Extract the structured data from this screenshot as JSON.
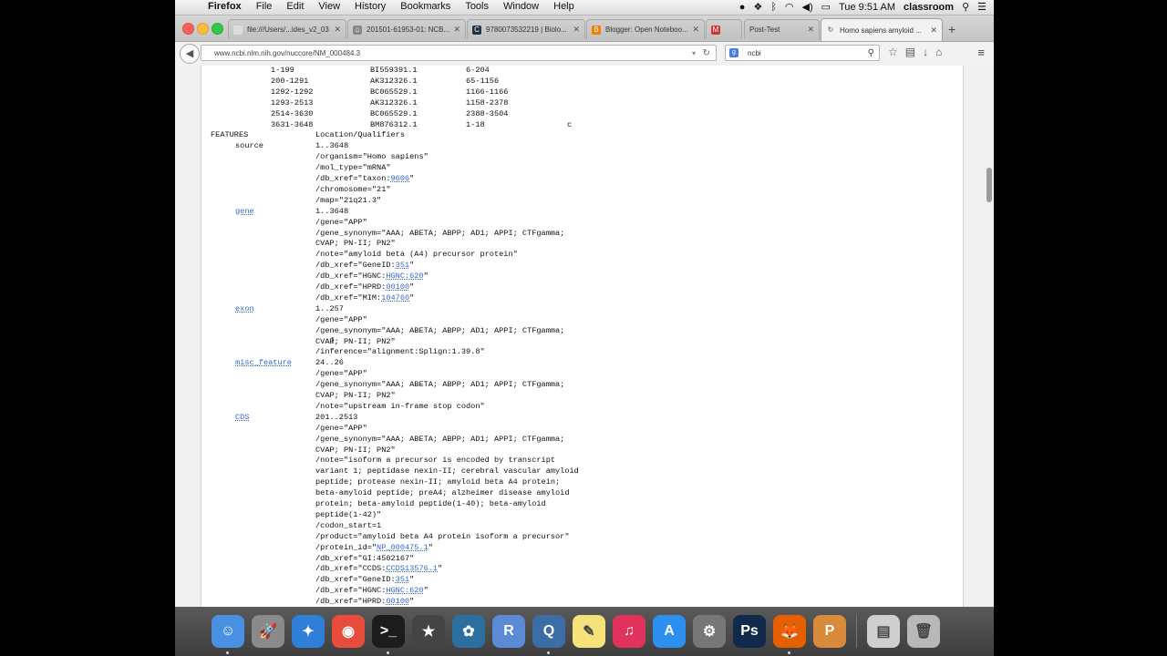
{
  "menubar": {
    "apple": "",
    "app_name": "Firefox",
    "menus": [
      "File",
      "Edit",
      "View",
      "History",
      "Bookmarks",
      "Tools",
      "Window",
      "Help"
    ],
    "clock": "Tue 9:51 AM",
    "user": "classroom"
  },
  "tabs": [
    {
      "title": "file:///Users/...ides_v2_03.swf",
      "favicon": "file-icon",
      "active": false
    },
    {
      "title": "201501-61953-01: NCB...",
      "favicon": "document-icon",
      "active": false
    },
    {
      "title": "9780073532219 | Biolo...",
      "favicon": "cengage-icon",
      "active": false
    },
    {
      "title": "Blogger: Open Noteboo...",
      "favicon": "blogger-icon",
      "active": false
    },
    {
      "title": "",
      "favicon": "gmail-icon",
      "active": false
    },
    {
      "title": "Post-Test",
      "favicon": "",
      "active": false
    },
    {
      "title": "Homo sapiens amyloid ...",
      "favicon": "loading-icon",
      "active": true
    }
  ],
  "navbar": {
    "url": "www.ncbi.nlm.nih.gov/nuccore/NM_000484.3",
    "search_value": "ncbi"
  },
  "genbank": {
    "primary": [
      {
        "range": "1-199",
        "acc": "BI559391.1",
        "span": "6-204",
        "comp": ""
      },
      {
        "range": "200-1291",
        "acc": "AK312326.1",
        "span": "65-1156",
        "comp": ""
      },
      {
        "range": "1292-1292",
        "acc": "BC065529.1",
        "span": "1166-1166",
        "comp": ""
      },
      {
        "range": "1293-2513",
        "acc": "AK312326.1",
        "span": "1158-2378",
        "comp": ""
      },
      {
        "range": "2514-3630",
        "acc": "BC065529.1",
        "span": "2388-3504",
        "comp": ""
      },
      {
        "range": "3631-3648",
        "acc": "BM876312.1",
        "span": "1-18",
        "comp": "c"
      }
    ],
    "features_header": {
      "key": "FEATURES",
      "value": "Location/Qualifiers"
    },
    "lines": [
      {
        "key": "source",
        "link": false,
        "parts": [
          {
            "t": "1..3648"
          }
        ]
      },
      {
        "parts": [
          {
            "t": "/organism=\"Homo sapiens\""
          }
        ]
      },
      {
        "parts": [
          {
            "t": "/mol_type=\"mRNA\""
          }
        ]
      },
      {
        "parts": [
          {
            "t": "/db_xref=\"taxon:"
          },
          {
            "t": "9606",
            "l": true
          },
          {
            "t": "\""
          }
        ]
      },
      {
        "parts": [
          {
            "t": "/chromosome=\"21\""
          }
        ]
      },
      {
        "parts": [
          {
            "t": "/map=\"21q21.3\""
          }
        ]
      },
      {
        "key": "gene",
        "link": true,
        "parts": [
          {
            "t": "1..3648"
          }
        ]
      },
      {
        "parts": [
          {
            "t": "/gene=\"APP\""
          }
        ]
      },
      {
        "parts": [
          {
            "t": "/gene_synonym=\"AAA; ABETA; ABPP; AD1; APPI; CTFgamma;"
          }
        ]
      },
      {
        "parts": [
          {
            "t": "CVAP; PN-II; PN2\""
          }
        ]
      },
      {
        "parts": [
          {
            "t": "/note=\"amyloid beta (A4) precursor protein\""
          }
        ]
      },
      {
        "parts": [
          {
            "t": "/db_xref=\"GeneID:"
          },
          {
            "t": "351",
            "l": true
          },
          {
            "t": "\""
          }
        ]
      },
      {
        "parts": [
          {
            "t": "/db_xref=\"HGNC:"
          },
          {
            "t": "HGNC:620",
            "l": true
          },
          {
            "t": "\""
          }
        ]
      },
      {
        "parts": [
          {
            "t": "/db_xref=\"HPRD:"
          },
          {
            "t": "00100",
            "l": true
          },
          {
            "t": "\""
          }
        ]
      },
      {
        "parts": [
          {
            "t": "/db_xref=\"MIM:"
          },
          {
            "t": "104760",
            "l": true
          },
          {
            "t": "\""
          }
        ]
      },
      {
        "key": "exon",
        "link": true,
        "parts": [
          {
            "t": "1..257"
          }
        ]
      },
      {
        "parts": [
          {
            "t": "/gene=\"APP\""
          }
        ]
      },
      {
        "parts": [
          {
            "t": "/gene_synonym=\"AAA; ABETA; ABPP; AD1; APPI; CTFgamma;"
          }
        ]
      },
      {
        "parts": [
          {
            "t": "CVAP; PN-II; PN2\""
          }
        ]
      },
      {
        "parts": [
          {
            "t": "/inference=\"alignment:Splign:1.39.8\""
          }
        ]
      },
      {
        "key": "misc_feature",
        "link": true,
        "parts": [
          {
            "t": "24..26"
          }
        ]
      },
      {
        "parts": [
          {
            "t": "/gene=\"APP\""
          }
        ]
      },
      {
        "parts": [
          {
            "t": "/gene_synonym=\"AAA; ABETA; ABPP; AD1; APPI; CTFgamma;"
          }
        ]
      },
      {
        "parts": [
          {
            "t": "CVAP; PN-II; PN2\""
          }
        ]
      },
      {
        "parts": [
          {
            "t": "/note=\"upstream in-frame stop codon\""
          }
        ]
      },
      {
        "key": "CDS",
        "link": true,
        "parts": [
          {
            "t": "201..2513"
          }
        ]
      },
      {
        "parts": [
          {
            "t": "/gene=\"APP\""
          }
        ]
      },
      {
        "parts": [
          {
            "t": "/gene_synonym=\"AAA; ABETA; ABPP; AD1; APPI; CTFgamma;"
          }
        ]
      },
      {
        "parts": [
          {
            "t": "CVAP; PN-II; PN2\""
          }
        ]
      },
      {
        "parts": [
          {
            "t": "/note=\"isoform a precursor is encoded by transcript"
          }
        ]
      },
      {
        "parts": [
          {
            "t": "variant 1; peptidase nexin-II; cerebral vascular amyloid"
          }
        ]
      },
      {
        "parts": [
          {
            "t": "peptide; protease nexin-II; amyloid beta A4 protein;"
          }
        ]
      },
      {
        "parts": [
          {
            "t": "beta-amyloid peptide; preA4; alzheimer disease amyloid"
          }
        ]
      },
      {
        "parts": [
          {
            "t": "protein; beta-amyloid peptide(1-40); beta-amyloid"
          }
        ]
      },
      {
        "parts": [
          {
            "t": "peptide(1-42)\""
          }
        ]
      },
      {
        "parts": [
          {
            "t": "/codon_start=1"
          }
        ]
      },
      {
        "parts": [
          {
            "t": "/product=\"amyloid beta A4 protein isoform a precursor\""
          }
        ]
      },
      {
        "parts": [
          {
            "t": "/protein_id=\""
          },
          {
            "t": "NP_000475.1",
            "l": true
          },
          {
            "t": "\""
          }
        ]
      },
      {
        "parts": [
          {
            "t": "/db_xref=\"GI:4502167\""
          }
        ]
      },
      {
        "parts": [
          {
            "t": "/db_xref=\"CCDS:"
          },
          {
            "t": "CCDS13576.1",
            "l": true
          },
          {
            "t": "\""
          }
        ]
      },
      {
        "parts": [
          {
            "t": "/db_xref=\"GeneID:"
          },
          {
            "t": "351",
            "l": true
          },
          {
            "t": "\""
          }
        ]
      },
      {
        "parts": [
          {
            "t": "/db_xref=\"HGNC:"
          },
          {
            "t": "HGNC:620",
            "l": true
          },
          {
            "t": "\""
          }
        ]
      },
      {
        "parts": [
          {
            "t": "/db_xref=\"HPRD:"
          },
          {
            "t": "00100",
            "l": true
          },
          {
            "t": "\""
          }
        ]
      }
    ]
  },
  "dock": [
    {
      "name": "finder-icon",
      "glyph": "☺",
      "bg": "#4a90e2",
      "running": true
    },
    {
      "name": "launchpad-icon",
      "glyph": "🚀",
      "bg": "#8a8a8a",
      "running": false
    },
    {
      "name": "safari-icon",
      "glyph": "✦",
      "bg": "#2f7fd8",
      "running": false
    },
    {
      "name": "chrome-icon",
      "glyph": "◉",
      "bg": "#e74c3c",
      "running": false
    },
    {
      "name": "terminal-icon",
      "glyph": ">_",
      "bg": "#1c1c1c",
      "running": true
    },
    {
      "name": "imovie-icon",
      "glyph": "★",
      "bg": "#444",
      "running": false
    },
    {
      "name": "molecule-app-icon",
      "glyph": "✿",
      "bg": "#2a6f9e",
      "running": false
    },
    {
      "name": "r-app-icon",
      "glyph": "R",
      "bg": "#5b8ad6",
      "running": false
    },
    {
      "name": "quicktime-icon",
      "glyph": "Q",
      "bg": "#3a6ea5",
      "running": true
    },
    {
      "name": "notes-icon",
      "glyph": "✎",
      "bg": "#f5e27a",
      "running": false
    },
    {
      "name": "itunes-icon",
      "glyph": "♫",
      "bg": "#e0325a",
      "running": false
    },
    {
      "name": "app-store-icon",
      "glyph": "A",
      "bg": "#2d8ff0",
      "running": false
    },
    {
      "name": "system-preferences-icon",
      "glyph": "⚙",
      "bg": "#777",
      "running": false
    },
    {
      "name": "photoshop-icon",
      "glyph": "Ps",
      "bg": "#0f2a4a",
      "running": false
    },
    {
      "name": "firefox-icon",
      "glyph": "🦊",
      "bg": "#e66000",
      "running": true
    },
    {
      "name": "preview-app-icon",
      "glyph": "P",
      "bg": "#d98a3a",
      "running": false
    },
    {
      "name": "downloads-stack-icon",
      "glyph": "▤",
      "bg": "#cfcfcf",
      "running": false
    },
    {
      "name": "trash-icon",
      "glyph": "🗑",
      "bg": "#b8b8b8",
      "running": false
    }
  ]
}
